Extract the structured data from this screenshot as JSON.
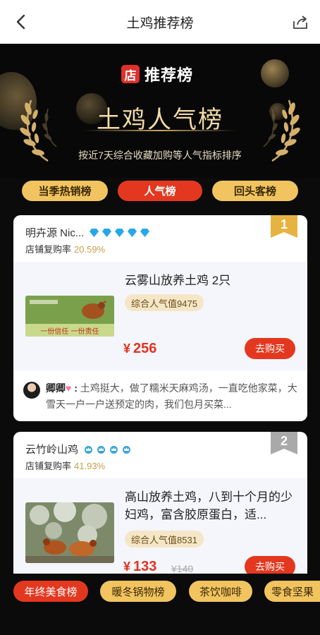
{
  "nav": {
    "title": "土鸡推荐榜",
    "back_icon": "chevron-left-icon",
    "share_icon": "share-icon"
  },
  "hero": {
    "brand_icon_char": "店",
    "brand_text": "推荐榜",
    "title": "土鸡人气榜",
    "subtitle": "按近7天综合收藏加购等人气指标排序"
  },
  "tabs": [
    {
      "label": "当季热销榜",
      "active": false
    },
    {
      "label": "人气榜",
      "active": true
    },
    {
      "label": "回头客榜",
      "active": false
    }
  ],
  "cards": [
    {
      "rank": "1",
      "shop_name": "明卉源 Nic...",
      "repurchase_label": "店铺复购率",
      "repurchase_value": "20.59%",
      "product_title": "云雾山放养土鸡 2只",
      "image_caption": "一份信任 一份责任",
      "popularity": "综合人气值9475",
      "price": "256",
      "currency": "¥",
      "buy_label": "去购买",
      "review_name": "卿卿",
      "review_text": "土鸡挺大，做了糯米天麻鸡汤，一直吃他家菜，大雪天一户一户送预定的肉，我们包月买菜..."
    },
    {
      "rank": "2",
      "shop_name": "云竹岭山鸡",
      "repurchase_label": "店铺复购率",
      "repurchase_value": "41.93%",
      "product_title": "高山放养土鸡，八到十个月的少妇鸡，富含胶原蛋白，适...",
      "popularity": "综合人气值8531",
      "price": "133",
      "old_price": "¥140",
      "currency": "¥",
      "buy_label": "去购买"
    }
  ],
  "bottom_tabs": [
    {
      "label": "年终美食榜",
      "active": true
    },
    {
      "label": "暖冬锅物榜",
      "active": false
    },
    {
      "label": "茶饮咖啡",
      "active": false
    },
    {
      "label": "零食坚果",
      "active": false
    }
  ],
  "colors": {
    "accent_red": "#e3381f",
    "gold": "#f2c45f",
    "hero_bg": "#080808"
  }
}
